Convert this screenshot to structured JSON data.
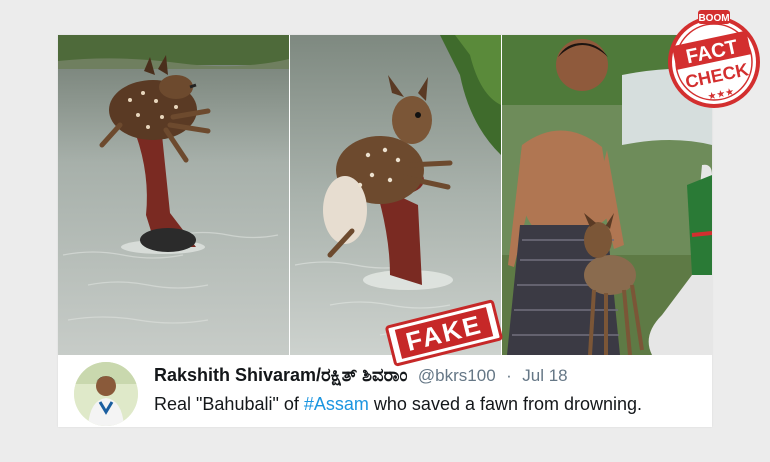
{
  "tweet": {
    "display_name": "Rakshith Shivaram/ರಕ್ಷಿತ್ ಶಿವರಾಂ",
    "handle": "@bkrs100",
    "separator": "·",
    "date": "Jul 18",
    "text_before": "Real \"Bahubali\" of ",
    "hashtag": "#Assam",
    "text_after": " who saved a fawn from drowning."
  },
  "stamp": {
    "label": "FAKE",
    "color": "#c62828"
  },
  "badge": {
    "top": "BOOM",
    "line1": "FACT",
    "line2": "CHECK",
    "stars": "★★★",
    "color": "#d32f2f"
  },
  "colors": {
    "link": "#1b95e0",
    "water": "#9aa59c"
  }
}
